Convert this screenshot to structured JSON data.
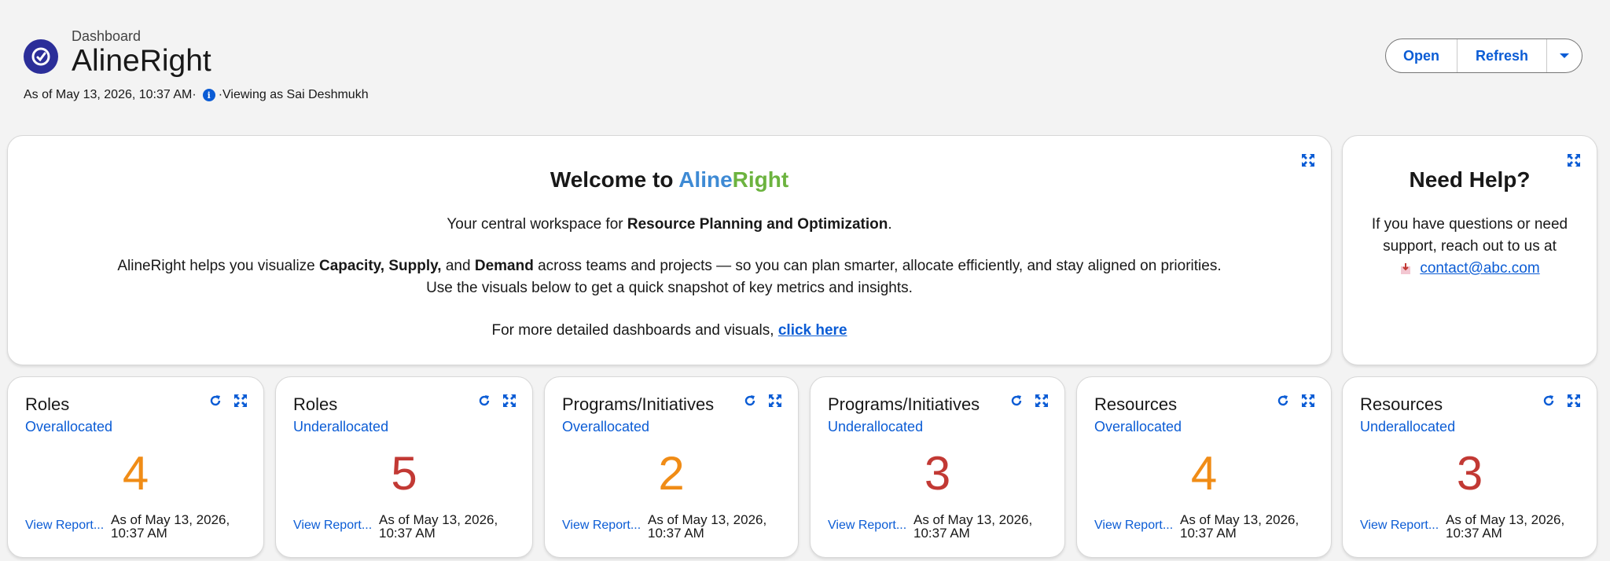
{
  "header": {
    "breadcrumb": "Dashboard",
    "title": "AlineRight",
    "as_of": "As of May 13, 2026, 10:37 AM·",
    "viewing_as": "·Viewing as Sai Deshmukh",
    "buttons": {
      "open": "Open",
      "refresh": "Refresh"
    }
  },
  "welcome": {
    "title_prefix": "Welcome to ",
    "brand_part1": "Aline",
    "brand_part2": "Right",
    "line1_prefix": "Your central workspace for ",
    "line1_bold": "Resource Planning and Optimization",
    "line1_suffix": ".",
    "line2_prefix": "AlineRight helps you visualize ",
    "line2_bold1": "Capacity, Supply,",
    "line2_mid": " and ",
    "line2_bold2": "Demand",
    "line2_suffix": " across teams and projects — so you can plan smarter, allocate efficiently, and stay aligned on priorities.",
    "line3": "Use the visuals below to get a quick snapshot of key metrics and insights.",
    "line4_prefix": "For more detailed dashboards and visuals, ",
    "line4_link": "click here"
  },
  "help": {
    "title": "Need Help?",
    "line1": "If you have questions or need",
    "line2": "support, reach out to us at",
    "email": "contact@abc.com"
  },
  "metrics": [
    {
      "title": "Roles",
      "subtitle": "Overallocated",
      "value": "4",
      "color": "#f08c16",
      "link": "View Report...",
      "date1": "As of May 13, 2026,",
      "date2": "10:37 AM"
    },
    {
      "title": "Roles",
      "subtitle": "Underallocated",
      "value": "5",
      "color": "#c23934",
      "link": "View Report...",
      "date1": "As of May 13, 2026,",
      "date2": "10:37 AM"
    },
    {
      "title": "Programs/Initiatives",
      "subtitle": "Overallocated",
      "value": "2",
      "color": "#f08c16",
      "link": "View Report...",
      "date1": "As of May 13, 2026,",
      "date2": "10:37 AM"
    },
    {
      "title": "Programs/Initiatives",
      "subtitle": "Underallocated",
      "value": "3",
      "color": "#c23934",
      "link": "View Report...",
      "date1": "As of May 13, 2026,",
      "date2": "10:37 AM"
    },
    {
      "title": "Resources",
      "subtitle": "Overallocated",
      "value": "4",
      "color": "#f08c16",
      "link": "View Report...",
      "date1": "As of May 13, 2026,",
      "date2": "10:37 AM"
    },
    {
      "title": "Resources",
      "subtitle": "Underallocated",
      "value": "3",
      "color": "#c23934",
      "link": "View Report...",
      "date1": "As of May 13, 2026,",
      "date2": "10:37 AM"
    }
  ],
  "colors": {
    "link": "#0b5cd5",
    "brand_blue": "#3e8ad4",
    "brand_green": "#6cb33f",
    "header_icon": "#2b2e99"
  },
  "icons": {
    "app": "dashboard-gauge-icon",
    "info": "info-icon",
    "menu": "chevron-down-icon",
    "expand": "expand-icon",
    "refresh": "refresh-icon",
    "email": "email-icon"
  }
}
